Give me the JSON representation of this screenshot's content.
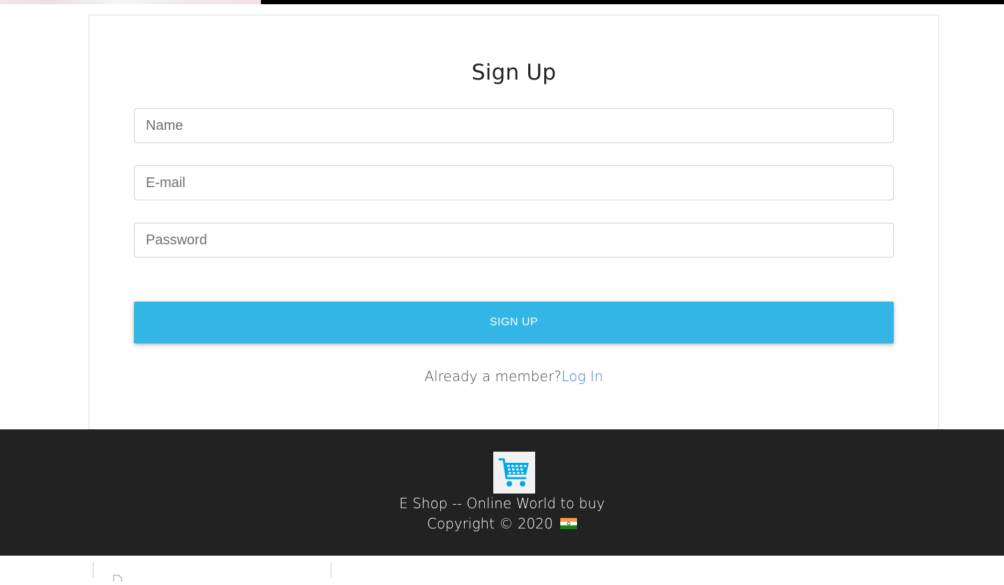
{
  "form": {
    "title": "Sign Up",
    "name_placeholder": "Name",
    "email_placeholder": "E-mail",
    "password_placeholder": "Password",
    "submit_label": "SIGN UP",
    "member_prompt": "Already a member?",
    "login_link": "Log In"
  },
  "footer": {
    "logo_icon": "shopping-cart-icon",
    "tagline": "E Shop -- Online World to buy",
    "copyright": "Copyright © 2020",
    "flag_icon": "india-flag-icon"
  },
  "colors": {
    "accent": "#33b5e5",
    "link": "#3b7ec0",
    "footer_bg": "#222222",
    "cart_icon": "#00a8e8"
  }
}
